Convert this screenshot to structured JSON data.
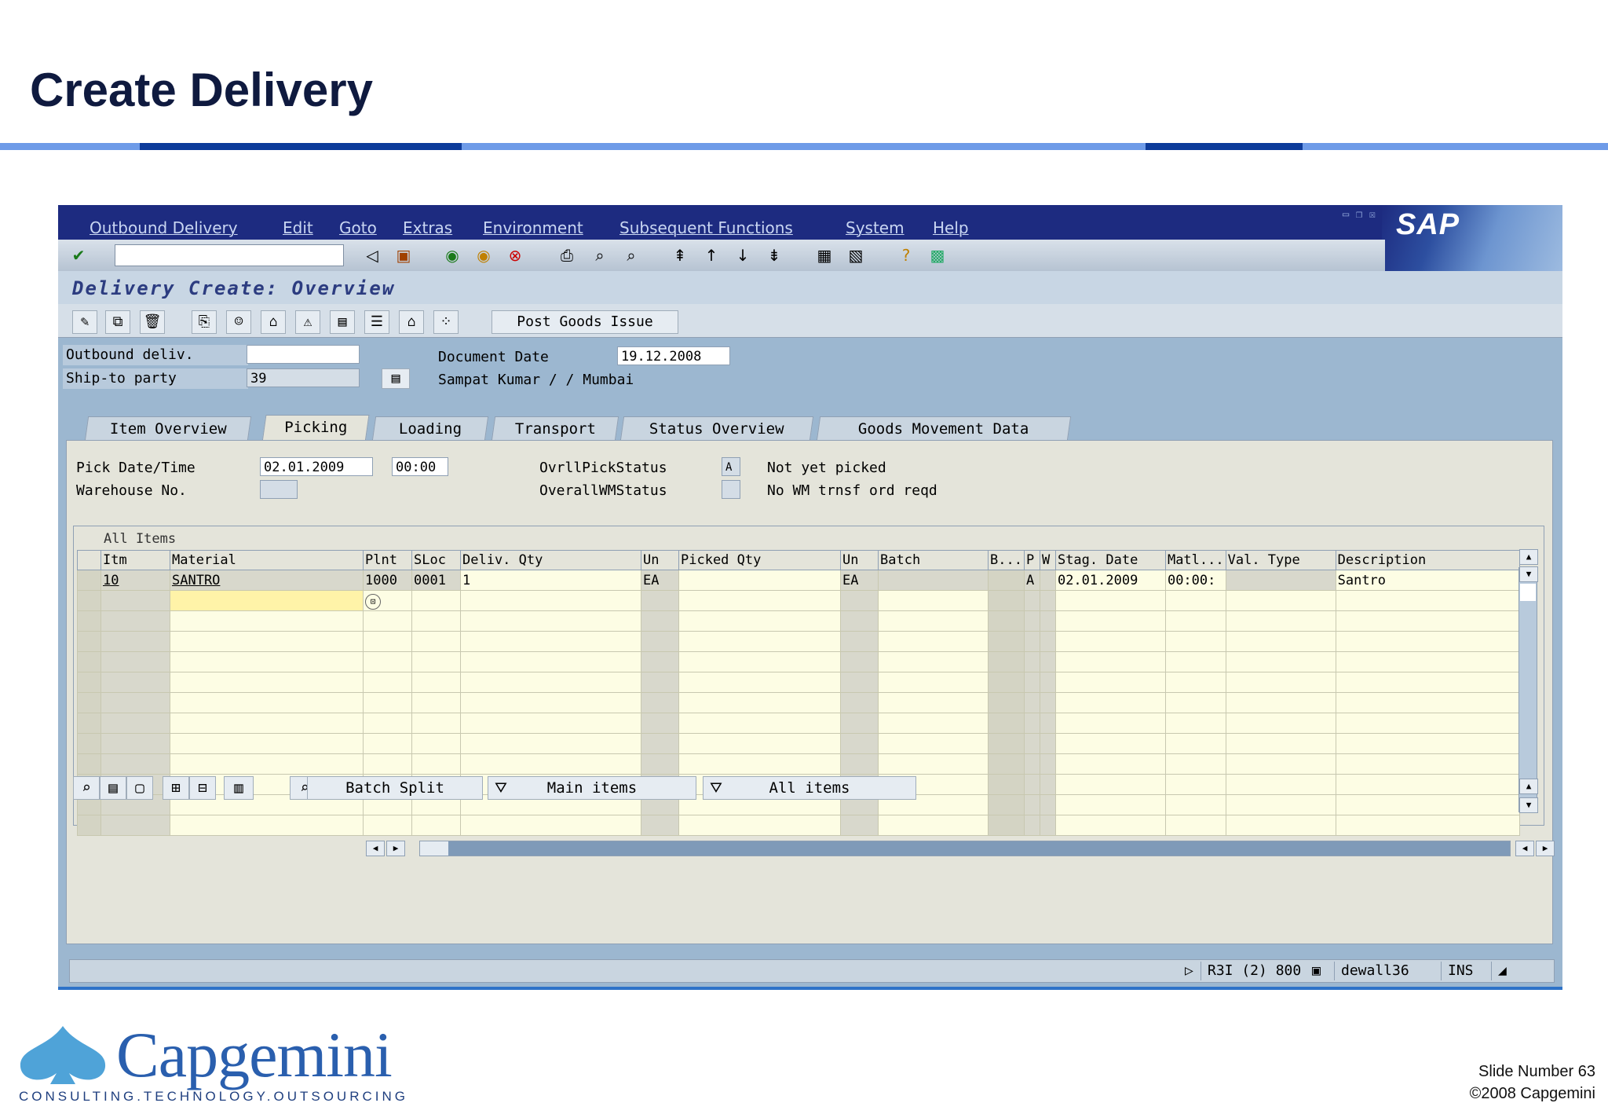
{
  "slide": {
    "title": "Create Delivery",
    "slide_number": "Slide Number 63",
    "copyright": "©2008 Capgemini",
    "logo_name": "Capgemini",
    "logo_tagline": "CONSULTING.TECHNOLOGY.OUTSOURCING"
  },
  "sap": {
    "logo": "SAP",
    "menu": [
      "Outbound Delivery",
      "Edit",
      "Goto",
      "Extras",
      "Environment",
      "Subsequent Functions",
      "System",
      "Help"
    ],
    "screen_title": "Delivery  Create: Overview",
    "post_goods_issue": "Post Goods Issue",
    "header": {
      "outbound_deliv_label": "Outbound deliv.",
      "outbound_deliv_value": "",
      "ship_to_label": "Ship-to party",
      "ship_to_value": "39",
      "doc_date_label": "Document Date",
      "doc_date_value": "19.12.2008",
      "ship_to_name": "Sampat Kumar / / Mumbai"
    },
    "tabs": [
      "Item Overview",
      "Picking",
      "Loading",
      "Transport",
      "Status Overview",
      "Goods Movement Data"
    ],
    "picking": {
      "pick_date_label": "Pick Date/Time",
      "pick_date": "02.01.2009",
      "pick_time": "00:00",
      "warehouse_label": "Warehouse No.",
      "ovrl_pick_label": "OvrllPickStatus",
      "ovrl_pick_code": "A",
      "ovrl_pick_text": "Not yet picked",
      "wm_status_label": "OverallWMStatus",
      "wm_status_text": "No WM trnsf ord reqd"
    },
    "grid": {
      "title": "All Items",
      "columns": [
        "Itm",
        "Material",
        "Plnt",
        "SLoc",
        "Deliv. Qty",
        "Un",
        "Picked Qty",
        "Un",
        "Batch",
        "B...",
        "P",
        "W",
        "Stag. Date",
        "Matl...",
        "Val. Type",
        "Description"
      ],
      "row1": [
        "10",
        "SANTRO",
        "1000",
        "0001",
        "1",
        "EA",
        "",
        "EA",
        "",
        "",
        "A",
        "",
        "02.01.2009",
        "00:00:",
        "",
        "Santro"
      ]
    },
    "buttons": {
      "batch_split": "Batch Split",
      "main_items": "Main items",
      "all_items": "All items"
    },
    "status": {
      "system": "R3I (2) 800",
      "user": "dewall36",
      "mode": "INS"
    }
  }
}
